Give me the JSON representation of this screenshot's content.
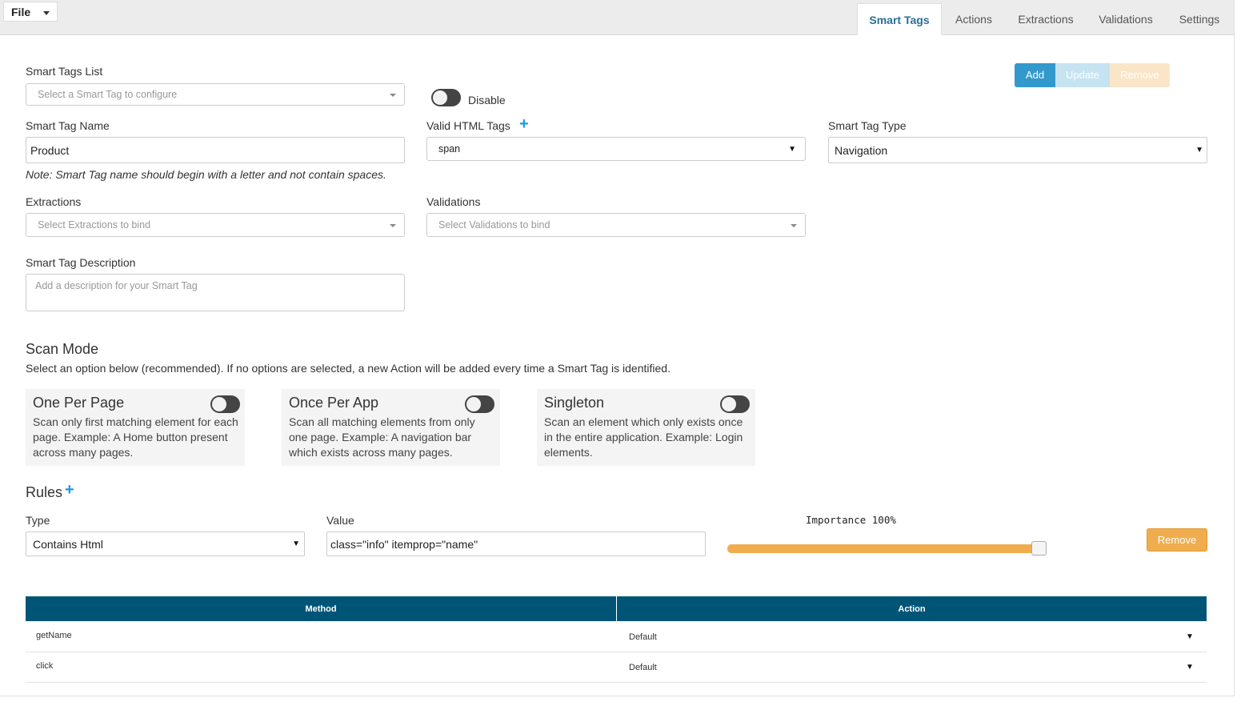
{
  "menu": {
    "file_label": "File"
  },
  "tabs": [
    "Smart Tags",
    "Actions",
    "Extractions",
    "Validations",
    "Settings"
  ],
  "toolbar": {
    "add": "Add",
    "update": "Update",
    "remove": "Remove"
  },
  "smart_tags_list": {
    "label": "Smart Tags List",
    "placeholder": "Select a Smart Tag to configure"
  },
  "disable": {
    "label": "Disable"
  },
  "name_field": {
    "label": "Smart Tag Name",
    "value": "Product",
    "note": "Note: Smart Tag name should begin with a letter and not contain spaces."
  },
  "html_tags": {
    "label": "Valid HTML Tags",
    "value": "span"
  },
  "tag_type": {
    "label": "Smart Tag Type",
    "value": "Navigation"
  },
  "extractions": {
    "label": "Extractions",
    "placeholder": "Select Extractions to bind"
  },
  "validations": {
    "label": "Validations",
    "placeholder": "Select Validations to bind"
  },
  "description": {
    "label": "Smart Tag Description",
    "placeholder": "Add a description for your Smart Tag"
  },
  "scan_mode": {
    "title": "Scan Mode",
    "subtitle": "Select an option below (recommended). If no options are selected, a new Action will be added every time a Smart Tag is identified.",
    "options": [
      {
        "title": "One Per Page",
        "desc": "Scan only first matching element for each page. Example: A Home button present across many pages."
      },
      {
        "title": "Once Per App",
        "desc": "Scan all matching elements from only one page. Example: A navigation bar which exists across many pages."
      },
      {
        "title": "Singleton",
        "desc": "Scan an element which only exists once in the entire application. Example: Login elements."
      }
    ]
  },
  "rules": {
    "title": "Rules",
    "type_label": "Type",
    "type_value": "Contains Html",
    "value_label": "Value",
    "value_value": "class=\"info\" itemprop=\"name\"",
    "importance_label": "Importance 100%",
    "importance": 1.0,
    "remove_label": "Remove"
  },
  "table": {
    "headers": [
      "Method",
      "Action"
    ],
    "rows": [
      {
        "method": "getName",
        "action": "Default"
      },
      {
        "method": "click",
        "action": "Default"
      }
    ]
  },
  "colors": {
    "add": "#3399cc",
    "update": "#c6e3f1",
    "remove_disabled": "#fbe5c8",
    "warning": "#f0ad4e",
    "table_header": "#005577",
    "accent": "#1f9ad6"
  }
}
